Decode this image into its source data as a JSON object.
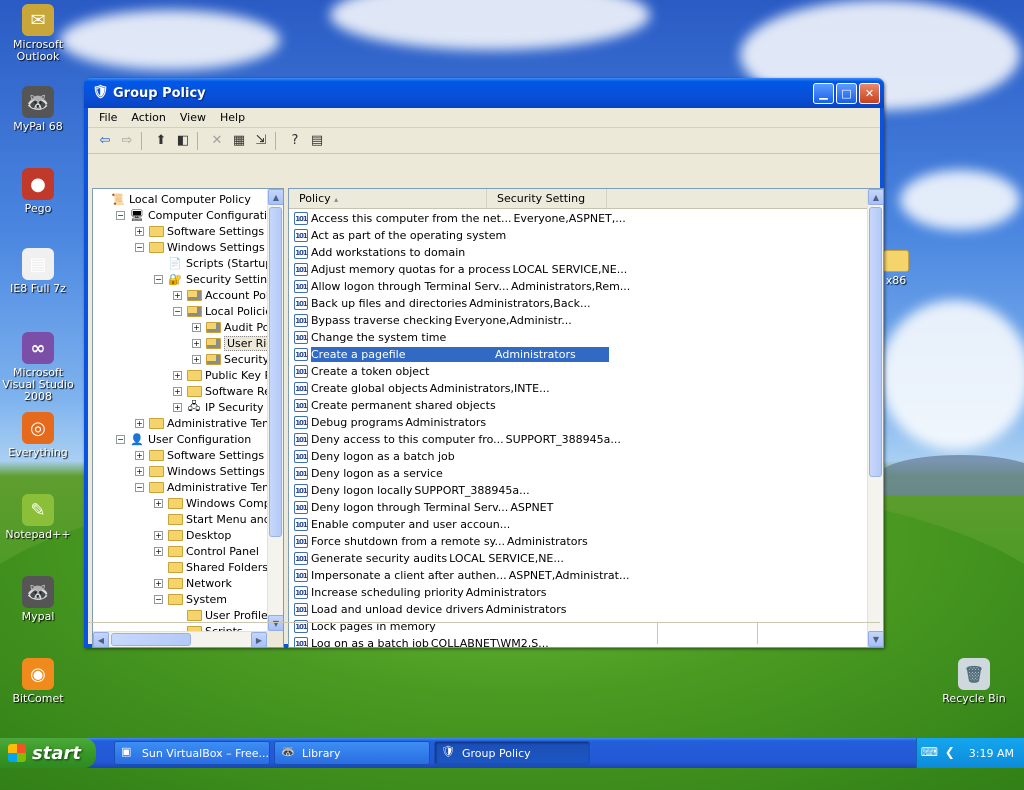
{
  "desktop": {
    "icons": [
      {
        "label": "Microsoft Outlook",
        "icon": "outlook-icon",
        "glyph": "✉",
        "color": "#c9a63a"
      },
      {
        "label": "MyPal 68",
        "icon": "raccoon-icon",
        "glyph": "🦝",
        "color": "#555555"
      },
      {
        "label": "Pego",
        "icon": "pego-icon",
        "glyph": "●",
        "color": "#c0392b"
      },
      {
        "label": "IE8 Full 7z",
        "icon": "archive-icon",
        "glyph": "▤",
        "color": "#f0f0f0"
      },
      {
        "label": "Microsoft Visual Studio 2008",
        "icon": "visual-studio-icon",
        "glyph": "∞",
        "color": "#7b4fa8"
      },
      {
        "label": "Everything",
        "icon": "everything-icon",
        "glyph": "◎",
        "color": "#e66a1c"
      },
      {
        "label": "Notepad++",
        "icon": "notepad-plus-icon",
        "glyph": "✎",
        "color": "#8bbf3a"
      },
      {
        "label": "Mypal",
        "icon": "raccoon-icon",
        "glyph": "🦝",
        "color": "#555555"
      },
      {
        "label": "BitComet",
        "icon": "bitcomet-icon",
        "glyph": "◉",
        "color": "#f08a1c"
      }
    ],
    "right_icons": [
      {
        "label": "x86",
        "icon": "folder-icon"
      },
      {
        "label": "Recycle Bin",
        "icon": "recycle-bin-icon"
      }
    ]
  },
  "window": {
    "title": "Group Policy",
    "menus": [
      "File",
      "Action",
      "View",
      "Help"
    ],
    "tree": [
      {
        "label": "Local Computer Policy",
        "indent": 0,
        "exp": "",
        "icon": "policy-icon"
      },
      {
        "label": "Computer Configuration",
        "indent": 1,
        "exp": "−",
        "icon": "computer-icon"
      },
      {
        "label": "Software Settings",
        "indent": 2,
        "exp": "+",
        "icon": "folder-icon"
      },
      {
        "label": "Windows Settings",
        "indent": 2,
        "exp": "−",
        "icon": "folder-icon"
      },
      {
        "label": "Scripts (Startup/Shu",
        "indent": 3,
        "exp": "",
        "icon": "script-icon"
      },
      {
        "label": "Security Settings",
        "indent": 3,
        "exp": "−",
        "icon": "security-icon"
      },
      {
        "label": "Account Policies",
        "indent": 4,
        "exp": "+",
        "icon": "folder-lock-icon"
      },
      {
        "label": "Local Policies",
        "indent": 4,
        "exp": "−",
        "icon": "folder-lock-icon"
      },
      {
        "label": "Audit Policy",
        "indent": 5,
        "exp": "+",
        "icon": "folder-lock-icon"
      },
      {
        "label": "User Rights",
        "indent": 5,
        "exp": "+",
        "icon": "folder-lock-icon",
        "selected": true
      },
      {
        "label": "Security Op",
        "indent": 5,
        "exp": "+",
        "icon": "folder-lock-icon"
      },
      {
        "label": "Public Key Polici",
        "indent": 4,
        "exp": "+",
        "icon": "folder-icon"
      },
      {
        "label": "Software Restr",
        "indent": 4,
        "exp": "+",
        "icon": "folder-icon"
      },
      {
        "label": "IP Security Polic",
        "indent": 4,
        "exp": "+",
        "icon": "ip-security-icon"
      },
      {
        "label": "Administrative Template",
        "indent": 2,
        "exp": "+",
        "icon": "folder-icon"
      },
      {
        "label": "User Configuration",
        "indent": 1,
        "exp": "−",
        "icon": "user-icon"
      },
      {
        "label": "Software Settings",
        "indent": 2,
        "exp": "+",
        "icon": "folder-icon"
      },
      {
        "label": "Windows Settings",
        "indent": 2,
        "exp": "+",
        "icon": "folder-icon"
      },
      {
        "label": "Administrative Template",
        "indent": 2,
        "exp": "−",
        "icon": "folder-icon"
      },
      {
        "label": "Windows Componer",
        "indent": 3,
        "exp": "+",
        "icon": "folder-icon"
      },
      {
        "label": "Start Menu and Tas",
        "indent": 3,
        "exp": "",
        "icon": "folder-icon"
      },
      {
        "label": "Desktop",
        "indent": 3,
        "exp": "+",
        "icon": "folder-icon"
      },
      {
        "label": "Control Panel",
        "indent": 3,
        "exp": "+",
        "icon": "folder-icon"
      },
      {
        "label": "Shared Folders",
        "indent": 3,
        "exp": "",
        "icon": "folder-icon"
      },
      {
        "label": "Network",
        "indent": 3,
        "exp": "+",
        "icon": "folder-icon"
      },
      {
        "label": "System",
        "indent": 3,
        "exp": "−",
        "icon": "folder-icon"
      },
      {
        "label": "User Profiles",
        "indent": 4,
        "exp": "",
        "icon": "folder-icon"
      },
      {
        "label": "Scripts",
        "indent": 4,
        "exp": "",
        "icon": "folder-icon"
      }
    ],
    "list": {
      "columns": [
        "Policy",
        "Security Setting"
      ],
      "rows": [
        {
          "policy": "Access this computer from the net...",
          "setting": "Everyone,ASPNET,..."
        },
        {
          "policy": "Act as part of the operating system",
          "setting": ""
        },
        {
          "policy": "Add workstations to domain",
          "setting": ""
        },
        {
          "policy": "Adjust memory quotas for a process",
          "setting": "LOCAL SERVICE,NE..."
        },
        {
          "policy": "Allow logon through Terminal Serv...",
          "setting": "Administrators,Rem..."
        },
        {
          "policy": "Back up files and directories",
          "setting": "Administrators,Back..."
        },
        {
          "policy": "Bypass traverse checking",
          "setting": "Everyone,Administr..."
        },
        {
          "policy": "Change the system time",
          "setting": ""
        },
        {
          "policy": "Create a pagefile",
          "setting": "Administrators",
          "selected": true
        },
        {
          "policy": "Create a token object",
          "setting": ""
        },
        {
          "policy": "Create global objects",
          "setting": "Administrators,INTE..."
        },
        {
          "policy": "Create permanent shared objects",
          "setting": ""
        },
        {
          "policy": "Debug programs",
          "setting": "Administrators"
        },
        {
          "policy": "Deny access to this computer fro...",
          "setting": "SUPPORT_388945a..."
        },
        {
          "policy": "Deny logon as a batch job",
          "setting": ""
        },
        {
          "policy": "Deny logon as a service",
          "setting": ""
        },
        {
          "policy": "Deny logon locally",
          "setting": "SUPPORT_388945a..."
        },
        {
          "policy": "Deny logon through Terminal Serv...",
          "setting": "ASPNET"
        },
        {
          "policy": "Enable computer and user accoun...",
          "setting": ""
        },
        {
          "policy": "Force shutdown from a remote sy...",
          "setting": "Administrators"
        },
        {
          "policy": "Generate security audits",
          "setting": "LOCAL SERVICE,NE..."
        },
        {
          "policy": "Impersonate a client after authen...",
          "setting": "ASPNET,Administrat..."
        },
        {
          "policy": "Increase scheduling priority",
          "setting": "Administrators"
        },
        {
          "policy": "Load and unload device drivers",
          "setting": "Administrators"
        },
        {
          "policy": "Lock pages in memory",
          "setting": ""
        },
        {
          "policy": "Log on as a batch job",
          "setting": "COLLABNET\\WM2,S..."
        }
      ]
    }
  },
  "taskbar": {
    "start": "start",
    "buttons": [
      {
        "label": "Sun VirtualBox – Free...",
        "icon": "virtualbox-icon"
      },
      {
        "label": "Library",
        "icon": "raccoon-icon"
      },
      {
        "label": "Group Policy",
        "icon": "group-policy-icon",
        "active": true
      }
    ],
    "clock": "3:19 AM"
  },
  "colors": {
    "selection": "#316ac5",
    "titlebar": "#0a53e0",
    "taskbar": "#245edb",
    "start": "#3b9c29"
  }
}
